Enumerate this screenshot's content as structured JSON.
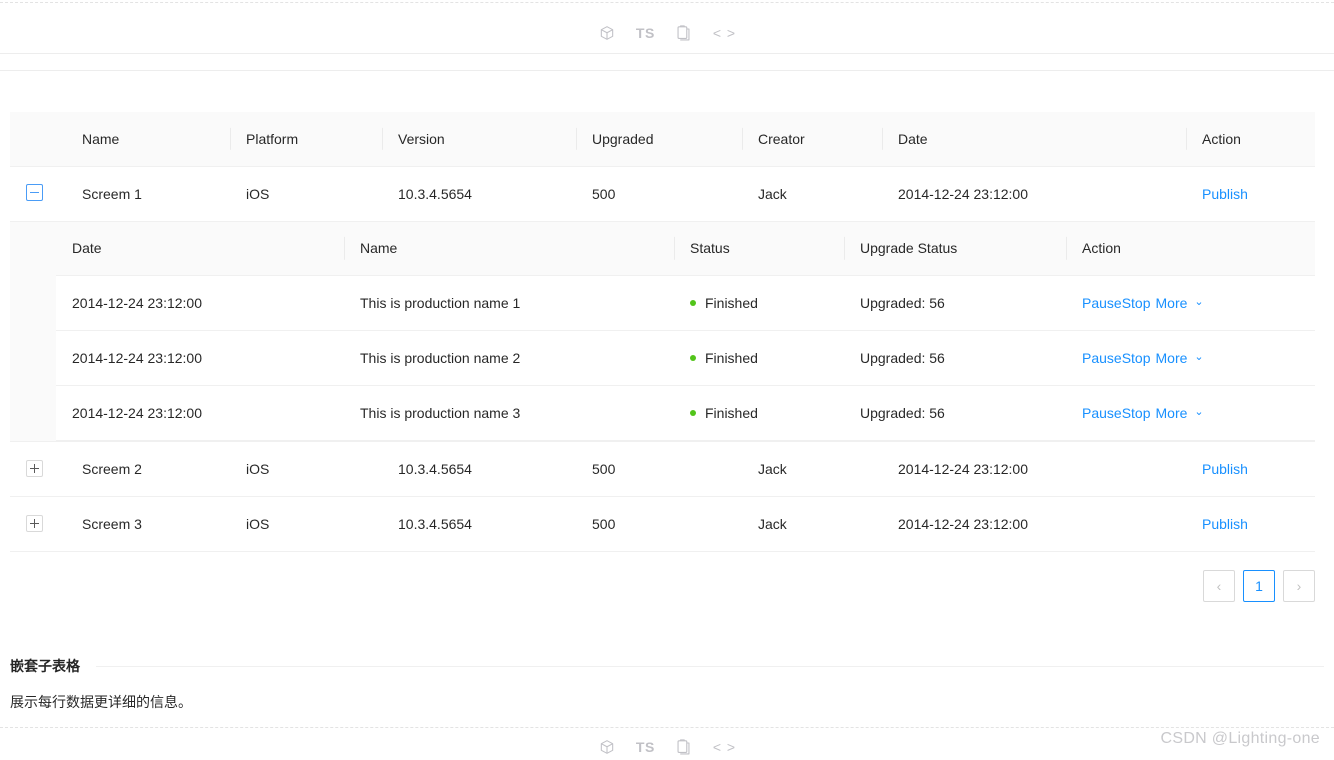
{
  "toolbar": {
    "icons": [
      {
        "name": "codesandbox-icon",
        "label": ""
      },
      {
        "name": "typescript-icon",
        "label": "TS"
      },
      {
        "name": "clipboard-icon",
        "label": ""
      },
      {
        "name": "code-brackets-icon",
        "label": "< >"
      }
    ]
  },
  "table": {
    "columns": [
      "Name",
      "Platform",
      "Version",
      "Upgraded",
      "Creator",
      "Date",
      "Action"
    ],
    "rows": [
      {
        "expanded": true,
        "expand_symbol": "−",
        "name": "Screem 1",
        "platform": "iOS",
        "version": "10.3.4.5654",
        "upgraded": "500",
        "creator": "Jack",
        "date": "2014-12-24 23:12:00",
        "action": "Publish"
      },
      {
        "expanded": false,
        "expand_symbol": "+",
        "name": "Screem 2",
        "platform": "iOS",
        "version": "10.3.4.5654",
        "upgraded": "500",
        "creator": "Jack",
        "date": "2014-12-24 23:12:00",
        "action": "Publish"
      },
      {
        "expanded": false,
        "expand_symbol": "+",
        "name": "Screem 3",
        "platform": "iOS",
        "version": "10.3.4.5654",
        "upgraded": "500",
        "creator": "Jack",
        "date": "2014-12-24 23:12:00",
        "action": "Publish"
      }
    ]
  },
  "sub_table": {
    "columns": [
      "Date",
      "Name",
      "Status",
      "Upgrade Status",
      "Action"
    ],
    "rows": [
      {
        "date": "2014-12-24 23:12:00",
        "name": "This is production name 1",
        "status": "Finished",
        "status_color": "#52c41a",
        "upgrade_status": "Upgraded: 56",
        "action_pause": "Pause",
        "action_stop": "Stop",
        "action_more": "More",
        "action_chevron": "⌄"
      },
      {
        "date": "2014-12-24 23:12:00",
        "name": "This is production name 2",
        "status": "Finished",
        "status_color": "#52c41a",
        "upgrade_status": "Upgraded: 56",
        "action_pause": "Pause",
        "action_stop": "Stop",
        "action_more": "More",
        "action_chevron": "⌄"
      },
      {
        "date": "2014-12-24 23:12:00",
        "name": "This is production name 3",
        "status": "Finished",
        "status_color": "#52c41a",
        "upgrade_status": "Upgraded: 56",
        "action_pause": "Pause",
        "action_stop": "Stop",
        "action_more": "More",
        "action_chevron": "⌄"
      }
    ]
  },
  "pagination": {
    "prev": "‹",
    "next": "›",
    "current_page": "1"
  },
  "section": {
    "title": "嵌套子表格",
    "description": "展示每行数据更详细的信息。"
  },
  "watermark": "CSDN @Lighting-one",
  "colors": {
    "link": "#1890ff",
    "success": "#52c41a",
    "header_bg": "#fafafa",
    "border": "#f0f0f0"
  }
}
